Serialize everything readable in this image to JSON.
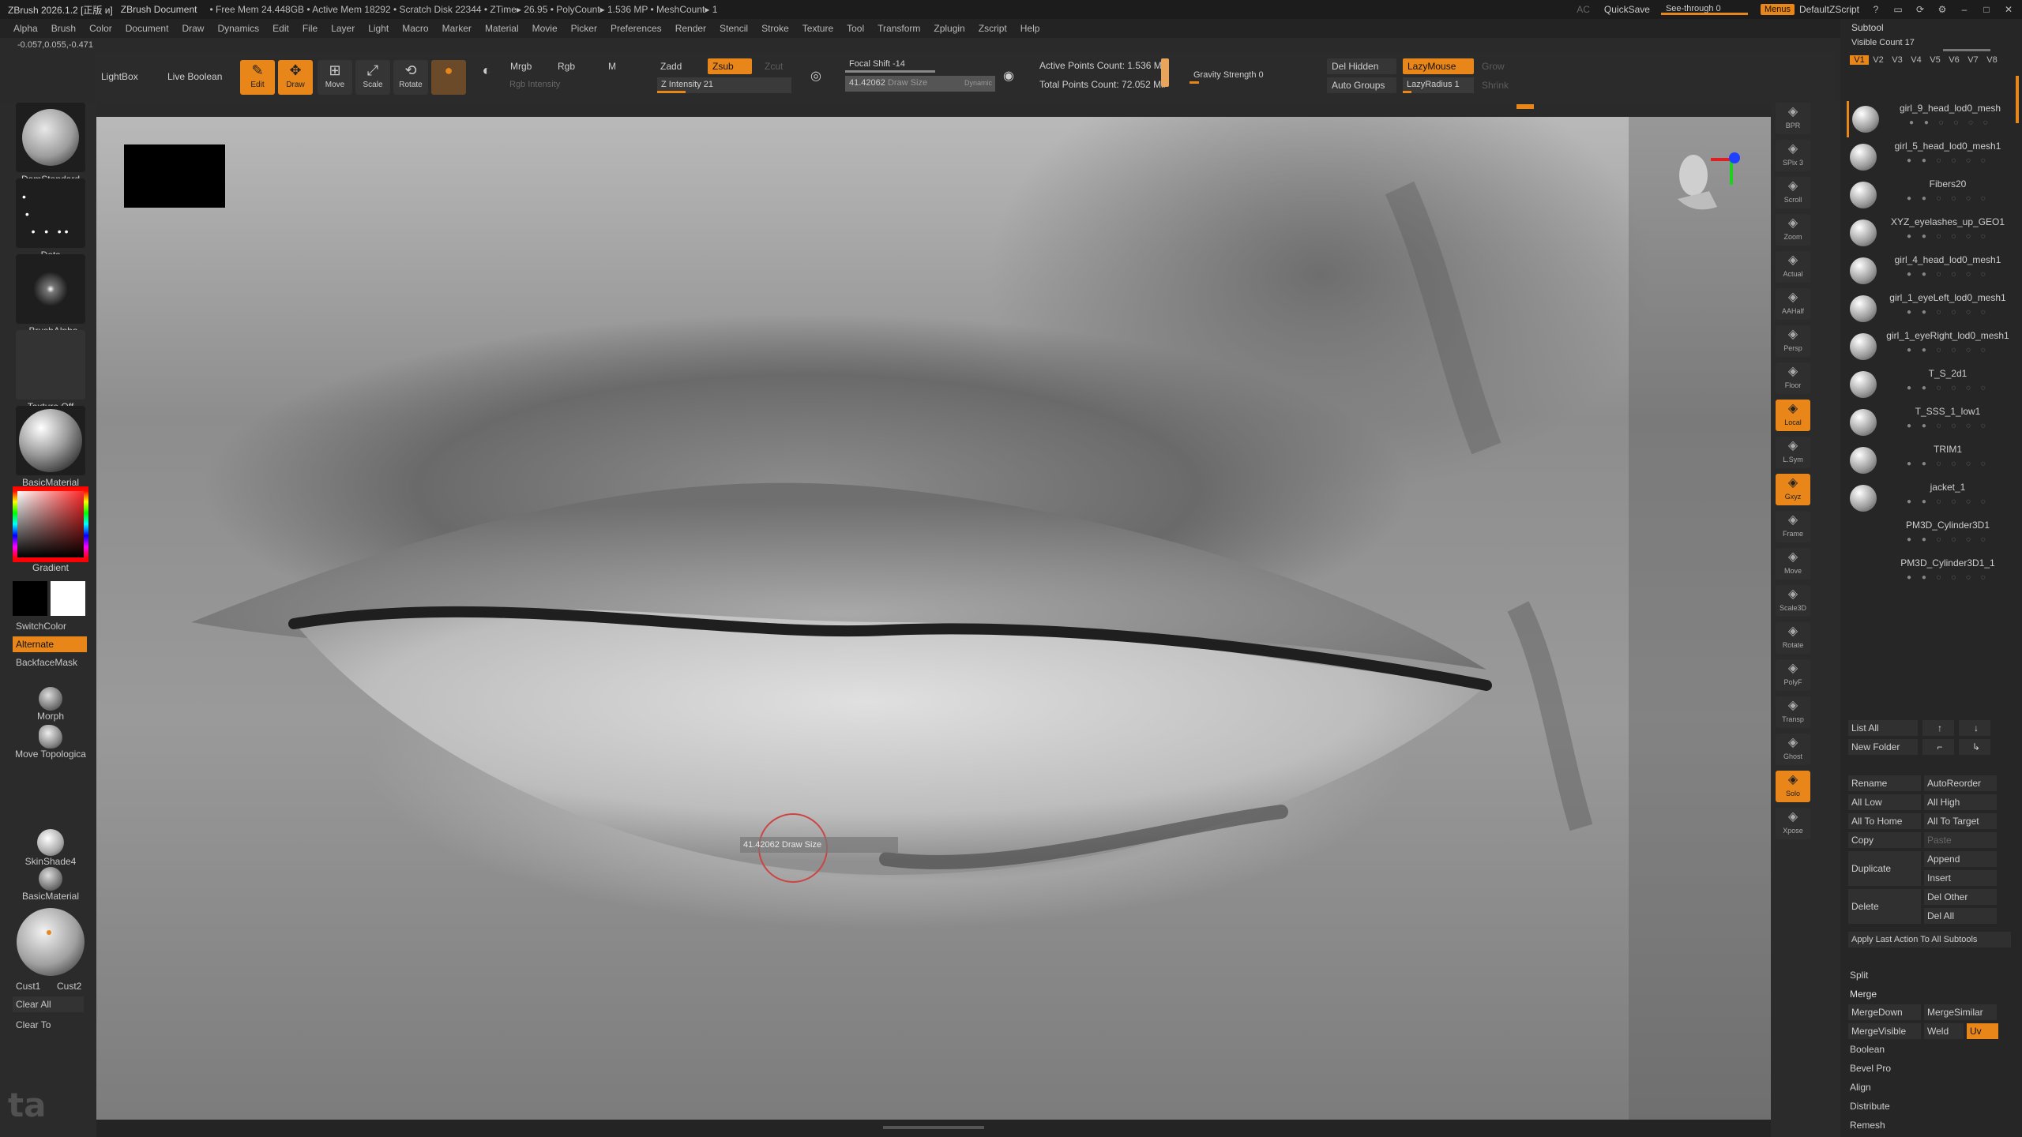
{
  "titlebar": {
    "app": "ZBrush 2026.1.2 [正版 и]",
    "doc": "ZBrush Document",
    "stats": "• Free Mem 24.448GB • Active Mem 18292 • Scratch Disk 22344 • ZTime▸ 26.95 • PolyCount▸ 1.536 MP • MeshCount▸ 1",
    "ac": "AC",
    "quicksave": "QuickSave",
    "see_through": "See-through 0",
    "menus": "Menus",
    "script": "DefaultZScript"
  },
  "menubar": [
    "Alpha",
    "Brush",
    "Color",
    "Document",
    "Draw",
    "Dynamics",
    "Edit",
    "File",
    "Layer",
    "Light",
    "Macro",
    "Marker",
    "Material",
    "Movie",
    "Picker",
    "Preferences",
    "Render",
    "Stencil",
    "Stroke",
    "Texture",
    "Tool",
    "Transform",
    "Zplugin",
    "Zscript",
    "Help"
  ],
  "coords": "-0.057,0.055,-0.471",
  "toolbar": {
    "lightbox": "LightBox",
    "live_boolean": "Live Boolean",
    "edit": "Edit",
    "draw": "Draw",
    "move": "Move",
    "scale": "Scale",
    "rotate": "Rotate",
    "mrgb": "Mrgb",
    "rgb": "Rgb",
    "m": "M",
    "rgb_intensity": "Rgb Intensity",
    "zadd": "Zadd",
    "zsub": "Zsub",
    "zcut": "Zcut",
    "z_intensity": "Z Intensity 21",
    "z_intensity_value": 0.21,
    "focal_shift": "Focal Shift -14",
    "draw_size": "41.42062",
    "draw_size_label": "Draw Size",
    "dynamic": "Dynamic",
    "active_points": "Active Points Count: 1.536 Mil",
    "total_points": "Total Points Count: 72.052 Mil",
    "gravity": "Gravity Strength 0",
    "del_hidden": "Del Hidden",
    "lazymouse": "LazyMouse",
    "grow": "Grow",
    "auto_groups": "Auto Groups",
    "lazyradius": "LazyRadius 1",
    "shrink": "Shrink"
  },
  "leftshelf": {
    "brush": "DamStandard",
    "stroke": "Dots",
    "alpha": "~BrushAlpha",
    "texture": "Texture Off",
    "material": "BasicMaterial",
    "gradient": "Gradient",
    "switchcolor": "SwitchColor",
    "alternate": "Alternate",
    "backfacemask": "BackfaceMask",
    "morph": "Morph",
    "move_topological": "Move Topologica",
    "skinshade": "SkinShade4",
    "basicmaterial2": "BasicMaterial",
    "cust1": "Cust1",
    "cust2": "Cust2",
    "clear_all": "Clear All",
    "clear_to": "Clear To"
  },
  "viewport": {
    "readout": "41.42062  Draw Size",
    "watermark": "ta"
  },
  "rightshelf": [
    "BPR",
    "SPix 3",
    "Scroll",
    "Zoom",
    "Actual",
    "AAHalf",
    "Persp",
    "Floor",
    "Local",
    "L.Sym",
    "Gxyz",
    "Frame",
    "Move",
    "Scale3D",
    "Rotate",
    "PolyF",
    "Transp",
    "Ghost",
    "Solo",
    "Xpose"
  ],
  "subtool": {
    "title": "Subtool",
    "visible_count": "Visible Count 17",
    "vtabs": [
      "V1",
      "V2",
      "V3",
      "V4",
      "V5",
      "V6",
      "V7",
      "V8"
    ],
    "items": [
      "girl_9_head_lod0_mesh",
      "girl_5_head_lod0_mesh1",
      "Fibers20",
      "XYZ_eyelashes_up_GEO1",
      "girl_4_head_lod0_mesh1",
      "girl_1_eyeLeft_lod0_mesh1",
      "girl_1_eyeRight_lod0_mesh1",
      "T_S_2d1",
      "T_SSS_1_low1",
      "TRIM1",
      "jacket_1",
      "PM3D_Cylinder3D1",
      "PM3D_Cylinder3D1_1"
    ],
    "list_all": "List All",
    "new_folder": "New Folder",
    "rename": "Rename",
    "autoreorder": "AutoReorder",
    "all_low": "All Low",
    "all_high": "All High",
    "all_to_home": "All To Home",
    "all_to_target": "All To Target",
    "copy": "Copy",
    "paste": "Paste",
    "duplicate": "Duplicate",
    "append": "Append",
    "insert": "Insert",
    "delete": "Delete",
    "del_other": "Del Other",
    "del_all": "Del All",
    "apply_last": "Apply Last Action To All Subtools",
    "split": "Split",
    "merge": "Merge",
    "mergedown": "MergeDown",
    "mergesimilar": "MergeSimilar",
    "mergevisible": "MergeVisible",
    "weld": "Weld",
    "uv": "Uv",
    "boolean": "Boolean",
    "bevel_pro": "Bevel Pro",
    "align": "Align",
    "distribute": "Distribute",
    "remesh": "Remesh"
  },
  "colors": {
    "accent": "#e8861a",
    "panel": "#2b2b2b",
    "titlebar": "#1c1c1c"
  }
}
